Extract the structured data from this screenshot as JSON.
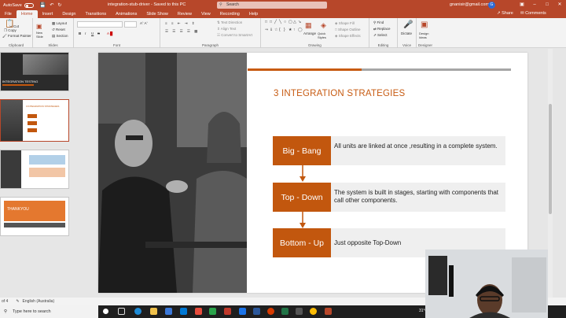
{
  "titlebar": {
    "autosave": "AutoSave",
    "toggle": "Off",
    "doc_title": "integration-stub-driver  -  Saved to this PC",
    "search_placeholder": "Search",
    "user": "gnanisir@gmail.com",
    "avatar": "G"
  },
  "tabs": [
    "File",
    "Home",
    "Insert",
    "Design",
    "Transitions",
    "Animations",
    "Slide Show",
    "Review",
    "View",
    "Recording",
    "Help"
  ],
  "active_tab": "Home",
  "share": "Share",
  "comments": "Comments",
  "ribbon": {
    "clipboard": {
      "label": "Clipboard",
      "paste": "Paste",
      "cut": "Cut",
      "copy": "Copy",
      "format_painter": "Format Painter"
    },
    "slides": {
      "label": "Slides",
      "new_slide": "New Slide",
      "layout": "Layout",
      "reset": "Reset",
      "section": "Section"
    },
    "font": {
      "label": "Font",
      "bold": "B",
      "italic": "I",
      "underline": "U",
      "strike": "S"
    },
    "paragraph": {
      "label": "Paragraph",
      "text_direction": "Text Direction",
      "align_text": "Align Text",
      "convert": "Convert to SmartArt"
    },
    "drawing": {
      "label": "Drawing",
      "arrange": "Arrange",
      "quick_styles": "Quick Styles",
      "shape_fill": "Shape Fill",
      "shape_outline": "Shape Outline",
      "shape_effects": "Shape Effects"
    },
    "editing": {
      "label": "Editing",
      "find": "Find",
      "replace": "Replace",
      "select": "Select"
    },
    "voice": {
      "label": "Voice",
      "dictate": "Dictate"
    },
    "designer": {
      "label": "Designer",
      "design_ideas": "Design Ideas"
    }
  },
  "thumbnails": [
    {
      "num": "1",
      "title": "INTEGRATION TESTING"
    },
    {
      "num": "2",
      "title": "3 INTEGRATION STRATEGIES"
    },
    {
      "num": "3",
      "title": ""
    },
    {
      "num": "4",
      "title": "THANKYOU"
    }
  ],
  "slide": {
    "title": "3 INTEGRATION STRATEGIES",
    "rows": [
      {
        "label": "Big - Bang",
        "desc": "All units are linked at once ,resulting in a complete system."
      },
      {
        "label": "Top - Down",
        "desc": "The system is built in stages, starting with components that call other components."
      },
      {
        "label": "Bottom - Up",
        "desc": "Just opposite Top-Down"
      }
    ]
  },
  "statusbar": {
    "slide_info": "of 4",
    "language": "English (Australia)"
  },
  "taskbar": {
    "search": "Type here to search",
    "tray": "31°C"
  },
  "colors": {
    "accent": "#c2570e",
    "titlebar": "#b7472a",
    "gray_bar": "#a6a6a6"
  }
}
